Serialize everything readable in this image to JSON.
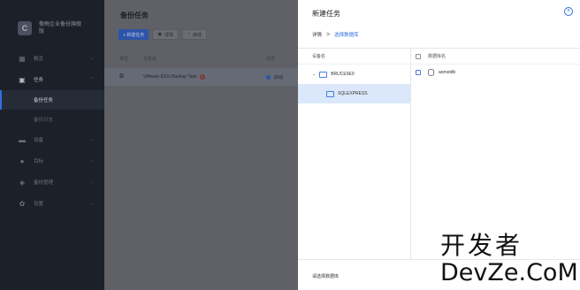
{
  "sidebar": {
    "brand": {
      "logo_letter": "C",
      "name": "傲梅企业备份旗舰版"
    },
    "items": [
      {
        "icon": "grid-icon",
        "label": "概览",
        "open": false
      },
      {
        "icon": "clipboard-icon",
        "label": "任务",
        "open": true
      },
      {
        "icon": "monitor-icon",
        "label": "设备",
        "open": false
      },
      {
        "icon": "location-icon",
        "label": "目标",
        "open": false
      },
      {
        "icon": "layers-icon",
        "label": "备份管理",
        "open": false
      },
      {
        "icon": "gear-icon",
        "label": "设置",
        "open": false
      }
    ],
    "subitems": [
      {
        "label": "备份任务",
        "active": true
      },
      {
        "label": "备份日志",
        "active": false
      }
    ]
  },
  "main": {
    "title": "备份任务",
    "toolbar": {
      "new_task": "+ 新建任务",
      "details": "详情",
      "start": "启动"
    },
    "columns": [
      "类型",
      "任务名",
      "状态"
    ],
    "row": {
      "task_name": "VMware ESXi Backup Task",
      "status": "启动"
    }
  },
  "drawer": {
    "title": "新建任务",
    "close_glyph": "×",
    "crumb": {
      "step1": "详情",
      "sep": ">",
      "step2": "选择数据库"
    },
    "left_header": "设备名",
    "right_header": "数据库名",
    "server": "BRUCE9E9",
    "instance": "SQLEXPRESS",
    "databases": [
      "aomeidb"
    ],
    "footer": "请选择数据库"
  },
  "watermark": {
    "line1": "开发者",
    "line2": "DevZe.CoM"
  },
  "colors": {
    "accent": "#2f6fe0",
    "sidebar_bg": "#1b2029",
    "selected_row": "#dbe8fb"
  }
}
